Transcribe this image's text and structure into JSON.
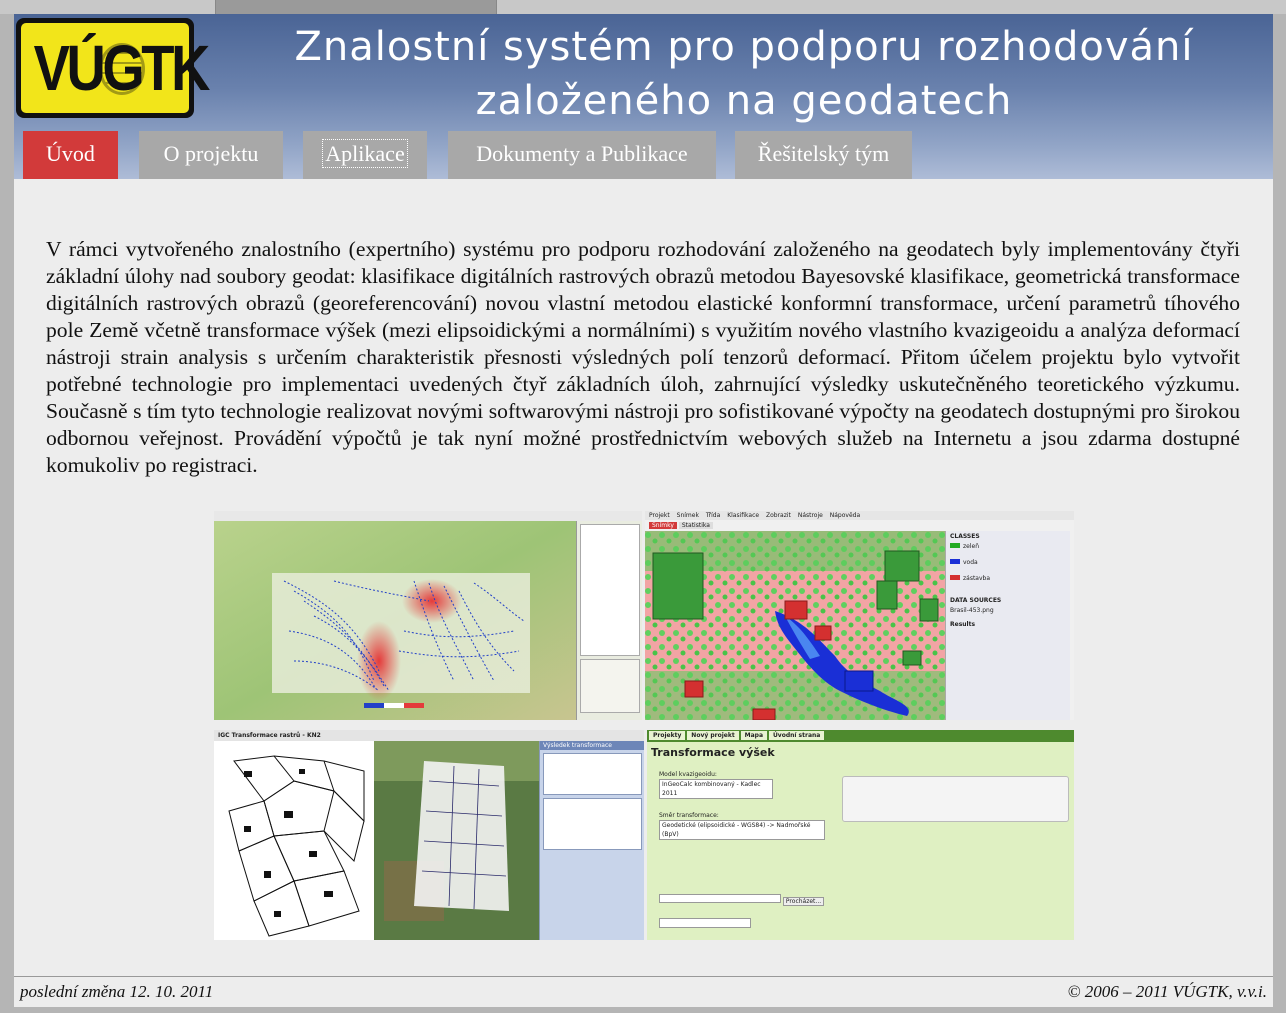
{
  "header": {
    "logo_text": "VÚGTK",
    "title_line1": "Znalostní systém pro podporu rozhodování",
    "title_line2": "založeného na geodatech"
  },
  "nav": [
    {
      "label": "Úvod",
      "active": true
    },
    {
      "label": "O projektu",
      "active": false
    },
    {
      "label": "Aplikace",
      "active": false
    },
    {
      "label": "Dokumenty a Publikace",
      "active": false
    },
    {
      "label": "Řešitelský tým",
      "active": false
    }
  ],
  "colors": {
    "nav_active": "#d23a3a",
    "nav_inactive": "#a8a8a8",
    "logo_yellow": "#f2e51a"
  },
  "main": {
    "paragraph": "V rámci vytvořeného znalostního (expertního) systému pro podporu rozhodování založeného na geodatech byly implementovány čtyři základní úlohy nad soubory geodat: klasifikace digitálních rastrových obrazů metodou Bayesovské klasifikace, geometrická transformace digitálních rastrových obrazů (georeferencování) novou vlastní metodou elastické konformní transformace, určení parametrů tíhového pole Země včetně transformace výšek (mezi elipsoidickými a normálními) s využitím nového vlastního kvazigeoidu a analýza deformací nástroji strain analysis s určením charakteristik přesnosti výsledných polí tenzorů deformací. Přitom účelem projektu bylo vytvořit potřebné technologie pro implementaci uvedených čtyř základních úloh, zahrnující výsledky uskutečněného teoretického výzkumu. Současně s tím tyto technologie realizovat novými softwarovými nástroji pro sofistikované výpočty na geodatech dostupnými pro širokou odbornou veřejnost. Provádění výpočtů je tak nyní možné prostřednictvím webových služeb na Internetu a jsou zdarma dostupné komukoliv po registraci."
  },
  "screens": {
    "classif": {
      "menu": [
        "Projekt",
        "Snímek",
        "Třída",
        "Klasifikace",
        "Zobrazit",
        "Nástroje",
        "Nápověda"
      ],
      "tabs": [
        "Snímky",
        "Statistika"
      ],
      "classes_title": "CLASSES",
      "classes": [
        "zeleň",
        "voda",
        "zástavba"
      ],
      "sources_title": "DATA SOURCES",
      "source": "Brasil-453.png",
      "results_title": "Results"
    },
    "igc": {
      "title": "IGC Transformace rastrů - KN2",
      "panel": "Výsledek transformace"
    },
    "heights": {
      "tabs": [
        "Projekty",
        "Nový projekt",
        "Mapa",
        "Úvodní strana"
      ],
      "title": "Transformace výšek",
      "model_label": "Model kvazigeoidu:",
      "model_value": "InGeoCalc kombinovaný - Kadlec 2011",
      "direction_label": "Směr transformace:",
      "direction_value": "Geodetické (elipsoidické - WGS84) -> Nadmořské (BpV)",
      "button": "Procházet..."
    }
  },
  "footer": {
    "left": "poslední změna 12. 10. 2011",
    "right": "© 2006 – 2011 VÚGTK, v.v.i."
  }
}
